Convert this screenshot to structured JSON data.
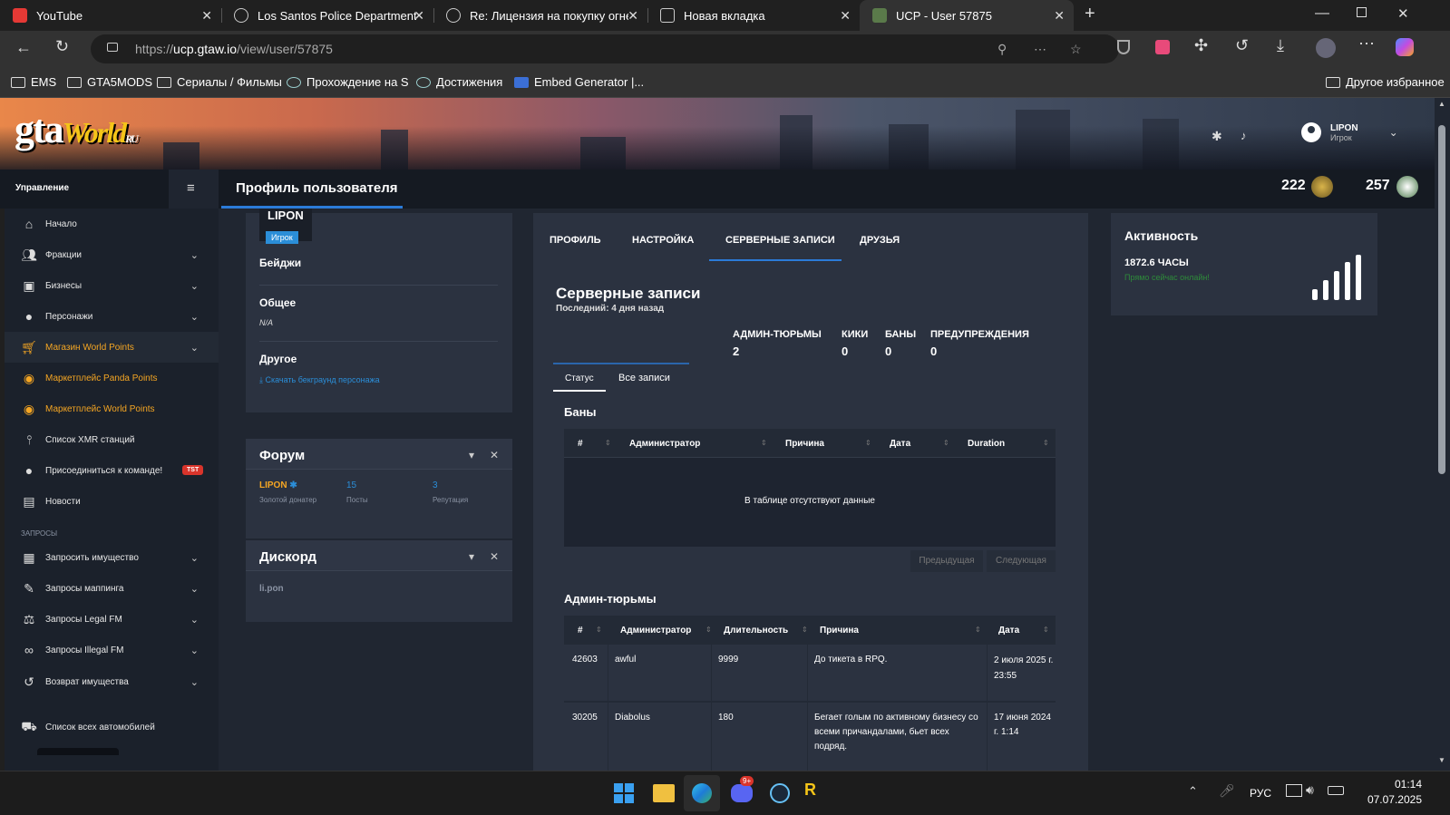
{
  "browser": {
    "tabs": [
      {
        "label": "YouTube",
        "color": "#e53935"
      },
      {
        "label": "Los Santos Police Department - H",
        "color": "#888888"
      },
      {
        "label": "Re: Лицензия на покупку огнест",
        "color": "#888888"
      },
      {
        "label": "Новая вкладка",
        "color": "#888888"
      },
      {
        "label": "UCP - User 57875",
        "color": "#4caf50"
      }
    ],
    "url_prefix": "https://",
    "url_host": "ucp.gtaw.io",
    "url_path": "/view/user/57875",
    "bookmarks": [
      "EMS",
      "GTA5MODS",
      "Сериалы / Фильмы",
      "Прохождение на S",
      "Достижения",
      "Embed Generator |..."
    ],
    "other_bookmarks": "Другое избранное"
  },
  "site": {
    "logo_main": "gta",
    "logo_accent": "World",
    "logo_suffix": "RU",
    "user_name": "LIPON",
    "user_role": "Игрок",
    "page_title": "Профиль пользователя",
    "points_1": "222",
    "points_2": "257"
  },
  "sidebar": {
    "header": "Управление",
    "items": [
      {
        "label": "Начало",
        "chev": false,
        "gold": false
      },
      {
        "label": "Фракции",
        "chev": true,
        "gold": false
      },
      {
        "label": "Бизнесы",
        "chev": true,
        "gold": false
      },
      {
        "label": "Персонажи",
        "chev": true,
        "gold": false
      },
      {
        "label": "Магазин World Points",
        "chev": true,
        "gold": true
      },
      {
        "label": "Маркетплейс Panda Points",
        "chev": false,
        "gold": true
      },
      {
        "label": "Маркетплейс World Points",
        "chev": false,
        "gold": true
      },
      {
        "label": "Список XMR станций",
        "chev": false,
        "gold": false
      },
      {
        "label": "Присоединиться к команде!",
        "chev": false,
        "gold": false
      },
      {
        "label": "Новости",
        "chev": false,
        "gold": false
      }
    ],
    "team_badge": "TST",
    "section2": "ЗАПРОСЫ",
    "items2": [
      {
        "label": "Запросить имущество"
      },
      {
        "label": "Запросы маппинга"
      },
      {
        "label": "Запросы Legal FM"
      },
      {
        "label": "Запросы Illegal FM"
      },
      {
        "label": "Возврат имущества"
      }
    ],
    "item_cars": "Список всех автомобилей"
  },
  "profile": {
    "name": "LIPON",
    "role_badge": "Игрок",
    "badges_label": "Бейджи",
    "general_label": "Общее",
    "general_value": "N/A",
    "other_label": "Другое",
    "download_link": "Скачать бекграунд персонажа"
  },
  "forum": {
    "title": "Форум",
    "user": "LIPON",
    "user_sub": "Золотой донатер",
    "posts": "15",
    "posts_label": "Посты",
    "rep": "3",
    "rep_label": "Репутация"
  },
  "discord": {
    "title": "Дискорд",
    "user": "li.pon"
  },
  "tabs": [
    "ПРОФИЛЬ",
    "НАСТРОЙКА",
    "СЕРВЕРНЫЕ ЗАПИСИ",
    "ДРУЗЬЯ"
  ],
  "records": {
    "title": "Серверные записи",
    "last": "Последний: 4 дня назад",
    "stats": [
      {
        "label": "АДМИН-ТЮРЬМЫ",
        "value": "2"
      },
      {
        "label": "КИКИ",
        "value": "0"
      },
      {
        "label": "БАНЫ",
        "value": "0"
      },
      {
        "label": "ПРЕДУПРЕЖДЕНИЯ",
        "value": "0"
      }
    ],
    "subtabs": [
      "Статус",
      "Все записи"
    ],
    "bans_title": "Баны",
    "bans_cols": [
      "#",
      "Администратор",
      "Причина",
      "Дата",
      "Duration"
    ],
    "bans_empty": "В таблице отсутствуют данные",
    "prev": "Предыдущая",
    "next": "Следующая",
    "jail_title": "Админ-тюрьмы",
    "jail_cols": [
      "#",
      "Администратор",
      "Длительность",
      "Причина",
      "Дата"
    ],
    "jail_rows": [
      {
        "id": "42603",
        "admin": "awful",
        "dur": "9999",
        "reason": "До тикета в RPQ.",
        "date": "2 июля 2025 г. 23:55"
      },
      {
        "id": "30205",
        "admin": "Diabolus",
        "dur": "180",
        "reason": "Бегает голым по активному бизнесу со всеми причандалами, бьет всех подряд.",
        "date": "17 июня 2024 г. 1:14"
      }
    ]
  },
  "activity": {
    "title": "Активность",
    "hours": "1872.6 ЧАСЫ",
    "status": "Прямо сейчас онлайн!"
  },
  "taskbar": {
    "lang": "РУС",
    "time": "01:14",
    "date": "07.07.2025",
    "discord_badge": "9+"
  }
}
